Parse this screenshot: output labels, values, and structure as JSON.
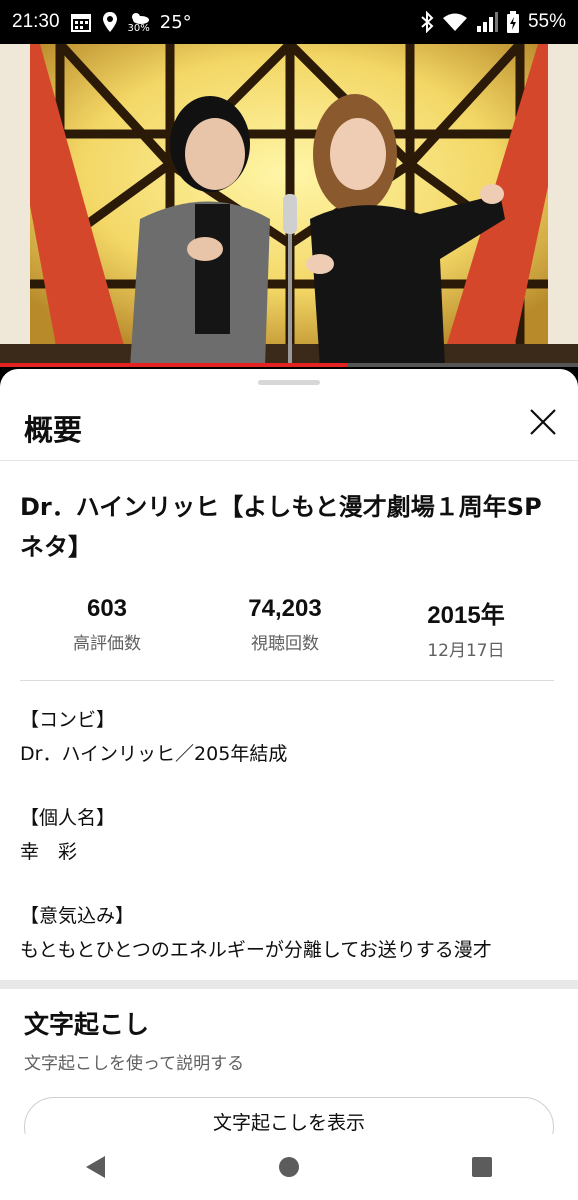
{
  "status_bar": {
    "time": "21:30",
    "weather_pct": "30%",
    "temperature": "25°",
    "battery": "55%",
    "icons": [
      "calendar-icon",
      "location-icon",
      "weather-icon",
      "bluetooth-icon",
      "wifi-icon",
      "signal-icon",
      "battery-icon"
    ]
  },
  "video": {
    "progress_fraction": 0.6
  },
  "sheet": {
    "title": "概要",
    "video_title": "Dr．ハインリッヒ【よしもと漫才劇場１周年SPネタ】",
    "stats": [
      {
        "value": "603",
        "label": "高評価数"
      },
      {
        "value": "74,203",
        "label": "視聴回数"
      },
      {
        "value": "2015年",
        "label": "12月17日"
      }
    ],
    "description": [
      "【コンビ】",
      "Dr．ハインリッヒ／205年結成",
      "【個人名】",
      "幸　彩",
      "【意気込み】",
      "もともとひとつのエネルギーが分離してお送りする漫才"
    ],
    "transcript": {
      "title": "文字起こし",
      "subtitle": "文字起こしを使って説明する",
      "button_label": "文字起こしを表示"
    }
  },
  "colors": {
    "progress": "#e52222",
    "text_primary": "#0f0f0f",
    "text_secondary": "#606060"
  }
}
